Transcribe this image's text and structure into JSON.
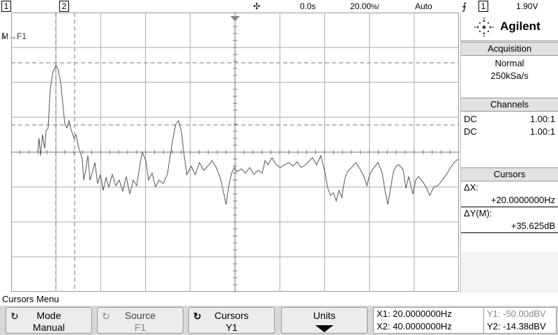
{
  "topbar": {
    "ch1": "1",
    "ch2": "2",
    "delay": "0.0s",
    "timebase": "20.00",
    "timebase_unit": "%/",
    "trigger_mode": "Auto",
    "trigger_source": "1",
    "trigger_level": "1.90V",
    "trigger_icon": "rising-edge-icon",
    "run_icon": "acquisition-status-icon"
  },
  "screen": {
    "marker_label": "M→F1",
    "colors": {
      "grid": "#aaaaaa",
      "trace": "#555555",
      "cursor": "#777777"
    }
  },
  "panel": {
    "brand": "Agilent",
    "acquisition": {
      "title": "Acquisition",
      "mode": "Normal",
      "rate": "250kSa/s"
    },
    "channels": {
      "title": "Channels",
      "rows": [
        {
          "coupling": "DC",
          "probe": "1.00:1"
        },
        {
          "coupling": "DC",
          "probe": "1.00:1"
        }
      ]
    },
    "cursors": {
      "title": "Cursors",
      "dx_label": "ΔX:",
      "dx_value": "+20.0000000Hz",
      "dy_label": "ΔY(M):",
      "dy_value": "+35.625dB"
    }
  },
  "menu": {
    "title": "Cursors Menu",
    "keys": [
      {
        "label": "Mode",
        "value": "Manual"
      },
      {
        "label": "Source",
        "value": "F1"
      },
      {
        "label": "Cursors",
        "value": "Y1"
      },
      {
        "label": "Units",
        "value": ""
      }
    ],
    "readout": {
      "x1": "X1: 20.0000000Hz",
      "x2": "X2: 40.0000000Hz",
      "y1": "Y1: -50.00dBV",
      "y2": "Y2: -14.38dBV"
    }
  }
}
